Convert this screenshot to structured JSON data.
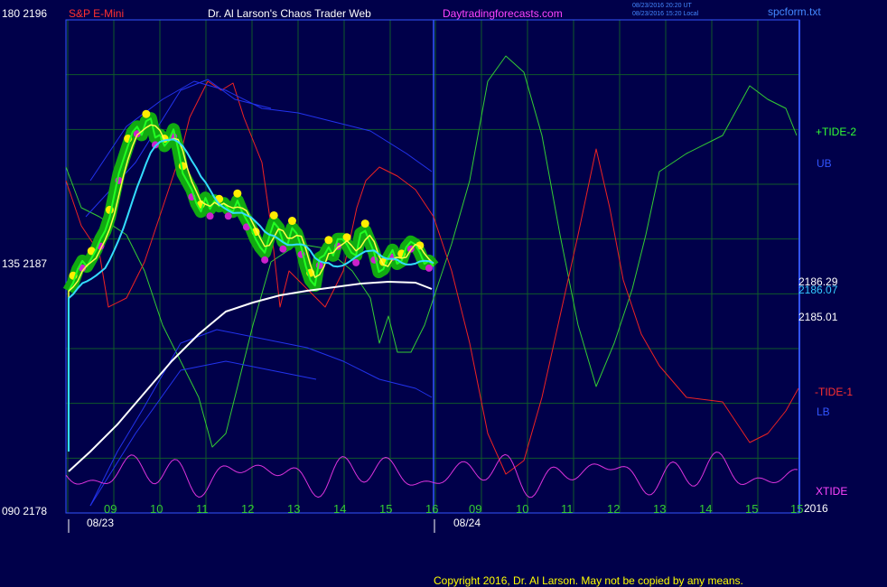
{
  "header": {
    "top_left": "180  2196",
    "instrument": "S&P E-Mini",
    "site_title": "Dr. Al Larson's Chaos Trader Web",
    "site_url": "Daytradingforecasts.com",
    "timestamp_ut": "08/23/2016 20:20 UT",
    "timestamp_local": "08/23/2016 15:20 Local",
    "file_label": "spcform.txt"
  },
  "axes": {
    "left_mid": "135  2187",
    "left_bottom": "090  2178",
    "date1": "08/23",
    "date2": "08/24"
  },
  "right_labels": {
    "tide2": "+TIDE-2",
    "ub": "UB",
    "price1": "2186.29",
    "price2": "2186.07",
    "price3": "2185.01",
    "tide1": "-TIDE-1",
    "lb": "LB",
    "xtide": "XTIDE",
    "year": "2016"
  },
  "footer": {
    "copyright": "Copyright 2016, Dr. Al Larson. May not be copied by any means."
  },
  "colors": {
    "background": "#00004a",
    "frame": "#3355ff",
    "grid": "#0f5a2a",
    "price": "#22ff22",
    "price_glow": "#11aa11",
    "top_dots": "#ffee00",
    "bottom_dots": "#cc22cc",
    "fast_avg": "#ffff44",
    "cyan_avg": "#33ddff",
    "white_avg": "#ffffff",
    "tide_green": "#33cc33",
    "tide_red": "#ee2222",
    "xtide": "#dd33dd",
    "bands": "#2233ee"
  },
  "chart_data": {
    "type": "line",
    "title": "S&P E-Mini",
    "ylim": [
      2178,
      2196
    ],
    "y_ticks": [
      2178,
      2187,
      2196
    ],
    "y_tide_ticks": [
      90,
      135,
      180
    ],
    "x_tick_labels": [
      "09",
      "10",
      "11",
      "12",
      "13",
      "14",
      "15",
      "16",
      "09",
      "10",
      "11",
      "12",
      "13",
      "14",
      "15",
      "15"
    ],
    "last_values": {
      "price": 2185.01,
      "cyan_avg": 2186.07,
      "white_avg": 2186.29
    },
    "series": [
      {
        "name": "S&P E-Mini",
        "x": [
          0,
          0.5,
          1,
          1.5,
          2,
          2.5,
          3,
          3.5,
          4,
          4.5,
          5,
          5.5,
          6,
          6.5,
          7,
          7.5,
          8,
          8.5,
          9,
          9.5,
          10,
          10.5,
          11,
          11.5,
          12,
          12.5,
          13,
          13.5,
          14,
          14.5,
          15,
          15.5,
          16,
          16.5,
          17,
          17.5,
          18,
          18.5,
          19,
          19.5,
          20,
          20.5,
          21,
          21.5,
          22,
          22.5,
          23,
          23.5,
          24,
          24.5,
          25,
          25.5,
          26,
          26.5,
          27,
          27.5,
          28,
          28.5,
          29,
          29.5,
          30,
          30.5,
          31,
          31.5,
          32,
          32.5,
          33,
          33.5,
          34,
          34.5,
          35,
          35.5,
          36,
          36.5,
          37,
          37.5,
          38,
          38.5,
          39,
          39.5,
          40,
          40.5,
          41,
          41.5,
          42,
          42.5,
          43,
          43.5,
          44,
          44.5,
          45,
          45.5,
          46,
          46.5,
          47,
          47.5,
          48,
          48.5,
          49,
          49.5,
          50,
          50.5,
          51,
          51.5,
          52,
          52.5,
          53,
          53.5,
          54,
          54.5,
          55,
          55.5,
          56,
          56.5,
          57,
          57.5,
          58,
          58.5,
          59,
          59.5,
          60,
          60.5,
          61,
          61.5,
          62,
          62.5,
          63,
          63.5,
          64,
          64.5,
          65,
          65.5,
          66,
          66.5,
          67,
          67.5,
          68,
          68.5,
          69,
          69.5,
          70,
          70.5,
          71,
          71.5,
          72,
          72.5,
          73,
          73.5,
          74,
          74.5,
          75,
          75.5,
          76,
          76.5,
          77,
          77.5,
          78,
          78.5,
          79,
          79.5,
          80,
          80.5,
          81,
          81.5,
          82,
          82.5,
          83
        ],
        "values": [
          2186.1,
          2186.4,
          2186.9,
          2187.2,
          2187.0,
          2187.3,
          2187.6,
          2188.0,
          2188.3,
          2188.8,
          2189.6,
          2190.4,
          2190.9,
          2191.4,
          2191.9,
          2192.1,
          2191.8,
          2192.3,
          2192.4,
          2191.7,
          2191.8,
          2191.4,
          2191.6,
          2192.0,
          2191.3,
          2190.4,
          2190.1,
          2189.8,
          2189.3,
          2189.0,
          2189.5,
          2189.1,
          2189.4,
          2189.2,
          2189.3,
          2189.1,
          2189.0,
          2189.4,
          2189.0,
          2188.7,
          2188.4,
          2188.0,
          2187.7,
          2187.5,
          2188.1,
          2188.6,
          2188.4,
          2187.9,
          2187.8,
          2188.4,
          2188.2,
          2187.7,
          2187.0,
          2186.5,
          2186.3,
          2187.3,
          2187.4,
          2187.7,
          2187.4,
          2188.0,
          2188.0,
          2187.8,
          2187.5,
          2187.4,
          2188.2,
          2188.3,
          2187.9,
          2187.5,
          2186.8,
          2186.9,
          2187.3,
          2187.6,
          2187.1,
          2187.2,
          2187.7,
          2187.9,
          2187.8,
          2187.5,
          2187.1,
          2187.2,
          2187.0,
          2186.4,
          2186.3,
          2186.2,
          2186.0,
          2185.7,
          2185.5,
          2185.5,
          2185.4,
          2185.3,
          2185.2,
          2185.4,
          2185.6,
          2185.3,
          2185.1,
          2185.2,
          2185.0,
          2185.1,
          2185.1,
          2185.0,
          2185.0,
          2185.0,
          2185.0,
          2185.0,
          2185.0,
          2185.0,
          2185.0,
          2185.0,
          2185.0,
          2185.0,
          2185.0,
          2185.0,
          2185.0,
          2185.0,
          2185.0,
          2185.0,
          2185.0,
          2185.0,
          2185.0,
          2185.0,
          2185.0,
          2185.0,
          2185.0,
          2185.0,
          2185.0,
          2185.0,
          2185.0,
          2185.0,
          2185.0,
          2185.0,
          2185.0,
          2185.0,
          2185.0,
          2185.0,
          2185.0,
          2185.0,
          2185.0,
          2185.0,
          2185.0,
          2185.0,
          2185.0,
          2185.0,
          2185.0,
          2185.0,
          2185.0,
          2185.0,
          2185.0,
          2185.0,
          2185.0,
          2185.0,
          2185.0,
          2185.0,
          2185.0,
          2185.0,
          2185.0,
          2185.0,
          2185.0,
          2185.0,
          2185.0,
          2185.0,
          2185.0,
          2185.0,
          2185.0,
          2185.0,
          2185.0,
          2185.0,
          2185.0
        ]
      }
    ]
  }
}
